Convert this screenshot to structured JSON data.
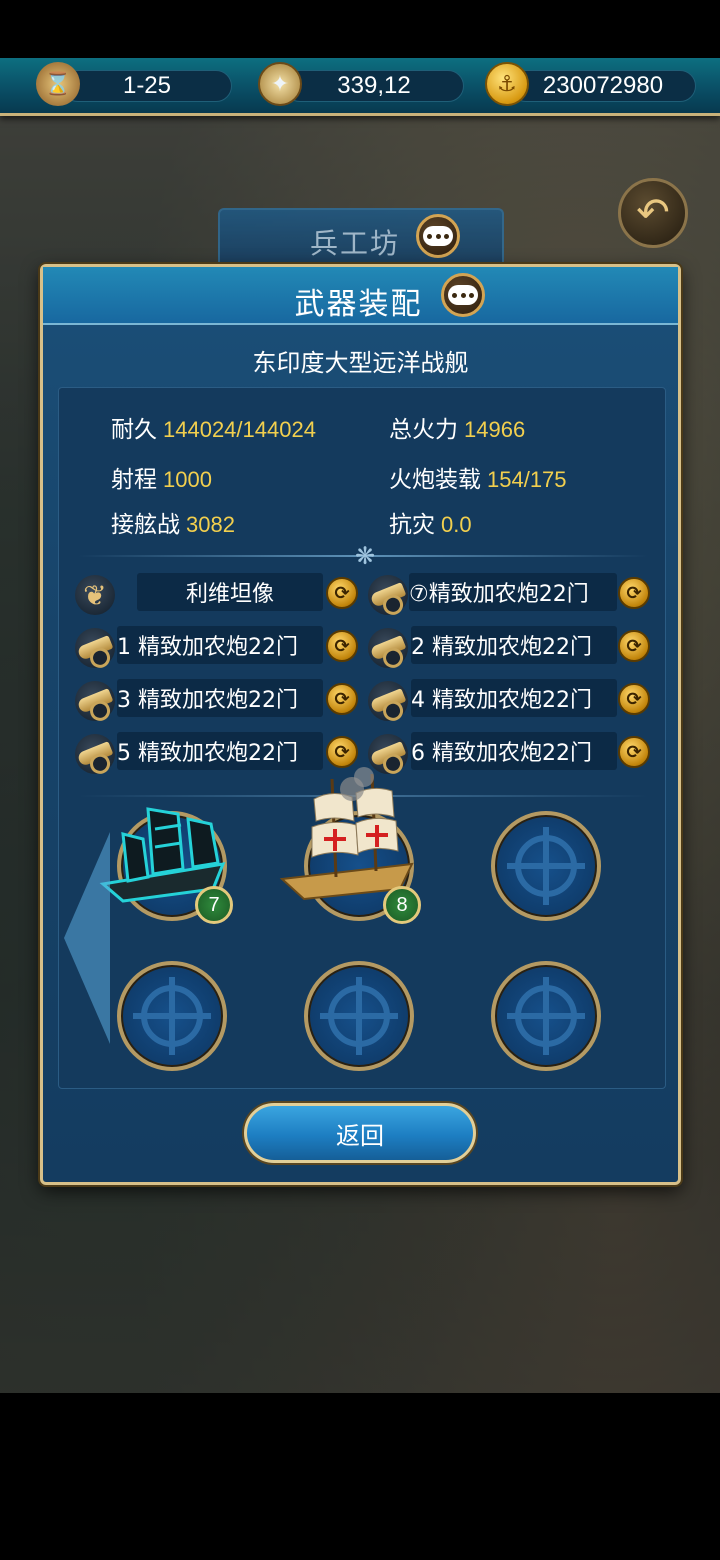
{
  "topbar": {
    "date": "1-25",
    "coords": "339,12",
    "gold": "230072980"
  },
  "background": {
    "tab_title": "兵工坊"
  },
  "dialog": {
    "title": "武器装配",
    "ship_name": "东印度大型远洋战舰",
    "stats": {
      "durability_label": "耐久",
      "durability_value": "144024/144024",
      "firepower_label": "总火力",
      "firepower_value": "14966",
      "range_label": "射程",
      "range_value": "1000",
      "cannon_load_label": "火炮装载",
      "cannon_load_value": "154/175",
      "boarding_label": "接舷战",
      "boarding_value": "3082",
      "disaster_label": "抗灾",
      "disaster_value": "0.0"
    },
    "figurehead": "利维坦像",
    "weapons": [
      "⑦精致加农炮22门",
      "1 精致加农炮22门",
      "2 精致加农炮22门",
      "3 精致加农炮22门",
      "4 精致加农炮22门",
      "5 精致加农炮22门",
      "6 精致加农炮22门"
    ],
    "fleet": [
      {
        "level": "7"
      },
      {
        "level": "8"
      }
    ],
    "return_label": "返回"
  },
  "colors": {
    "stat_value": "#f2cf4e",
    "panel": "#17446a",
    "frame": "#d7c089"
  }
}
